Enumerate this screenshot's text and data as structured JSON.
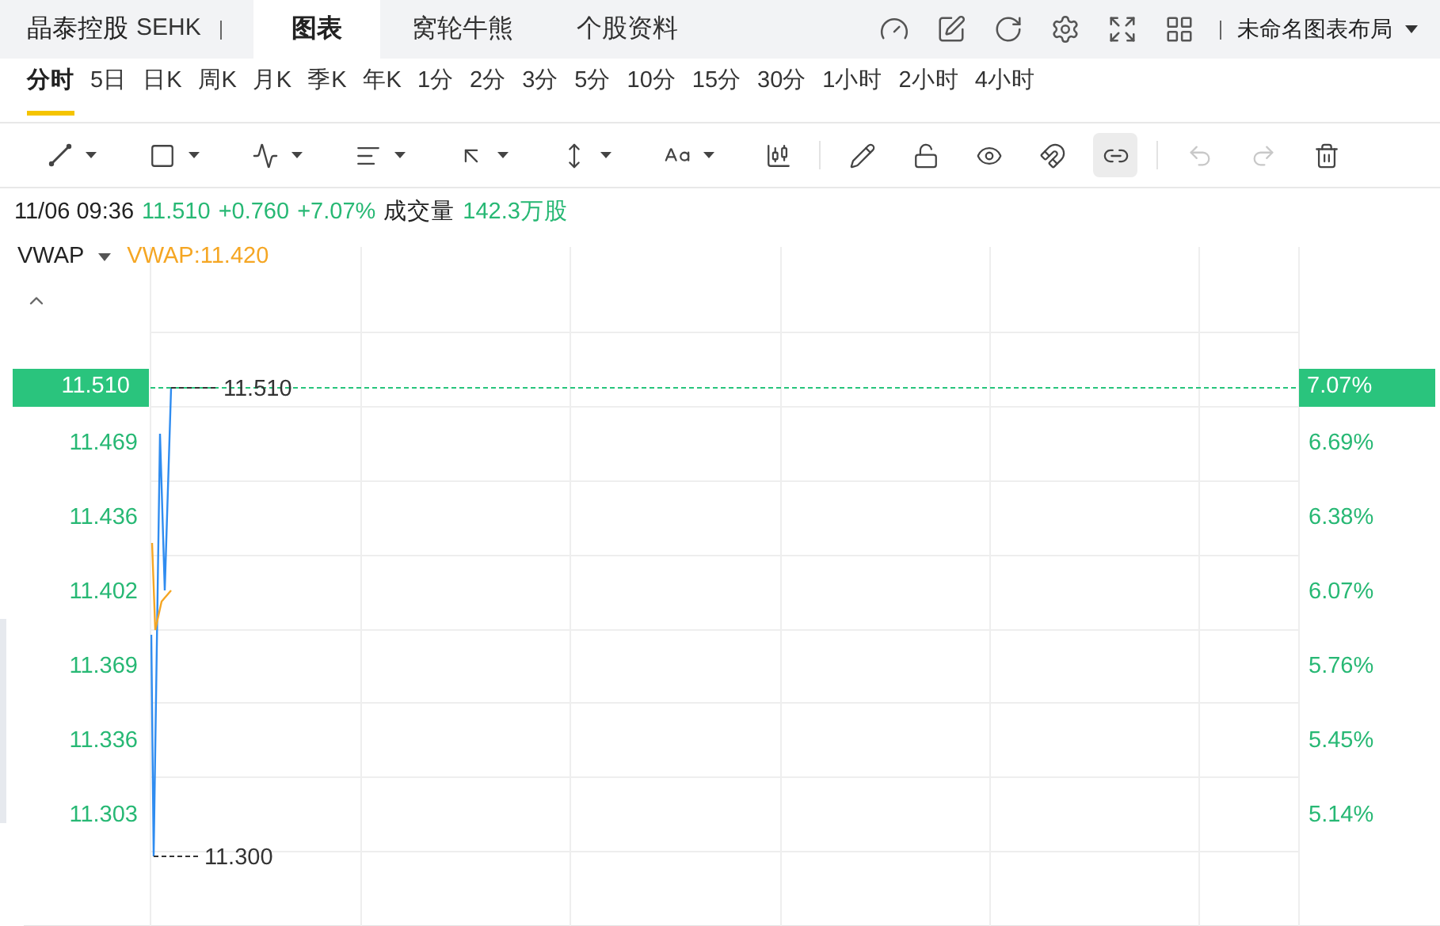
{
  "header": {
    "stock_name": "晶泰控股",
    "exchange": "SEHK",
    "tabs": [
      {
        "label": "图表",
        "selected": true
      },
      {
        "label": "窝轮牛熊",
        "selected": false
      },
      {
        "label": "个股资料",
        "selected": false
      }
    ],
    "layout_menu": "未命名图表布局"
  },
  "periods": [
    {
      "label": "分时",
      "selected": true
    },
    {
      "label": "5日",
      "selected": false
    },
    {
      "label": "日K",
      "selected": false
    },
    {
      "label": "周K",
      "selected": false
    },
    {
      "label": "月K",
      "selected": false
    },
    {
      "label": "季K",
      "selected": false
    },
    {
      "label": "年K",
      "selected": false
    },
    {
      "label": "1分",
      "selected": false
    },
    {
      "label": "2分",
      "selected": false
    },
    {
      "label": "3分",
      "selected": false
    },
    {
      "label": "5分",
      "selected": false
    },
    {
      "label": "10分",
      "selected": false
    },
    {
      "label": "15分",
      "selected": false
    },
    {
      "label": "30分",
      "selected": false
    },
    {
      "label": "1小时",
      "selected": false
    },
    {
      "label": "2小时",
      "selected": false
    },
    {
      "label": "4小时",
      "selected": false
    }
  ],
  "tools": [
    {
      "selected": false,
      "disabled": false
    },
    {
      "selected": false,
      "disabled": false
    },
    {
      "selected": false,
      "disabled": false
    },
    {
      "selected": false,
      "disabled": false
    },
    {
      "selected": false,
      "disabled": false
    },
    {
      "selected": false,
      "disabled": false
    },
    {
      "selected": false,
      "disabled": false
    },
    {
      "selected": false,
      "disabled": false
    },
    {
      "selected": false,
      "disabled": false
    },
    {
      "selected": false,
      "disabled": false
    },
    {
      "selected": false,
      "disabled": false
    },
    {
      "selected": false,
      "disabled": false
    },
    {
      "selected": true,
      "disabled": false
    },
    {
      "selected": false,
      "disabled": true
    },
    {
      "selected": false,
      "disabled": true
    },
    {
      "selected": false,
      "disabled": false
    }
  ],
  "quote": {
    "datetime": "11/06 09:36",
    "price": "11.510",
    "change": "+0.760",
    "change_pct": "+7.07%",
    "volume_label": "成交量",
    "volume": "142.3万股"
  },
  "indicator": {
    "name": "VWAP",
    "value": "VWAP:11.420"
  },
  "chart": {
    "price_axis": [
      "11.469",
      "11.436",
      "11.402",
      "11.369",
      "11.336",
      "11.303"
    ],
    "percent_axis": [
      "6.69%",
      "6.38%",
      "6.07%",
      "5.76%",
      "5.45%",
      "5.14%"
    ],
    "price_tag": "11.510",
    "percent_tag": "7.07%",
    "high_label": "11.510",
    "low_label": "11.300"
  }
}
